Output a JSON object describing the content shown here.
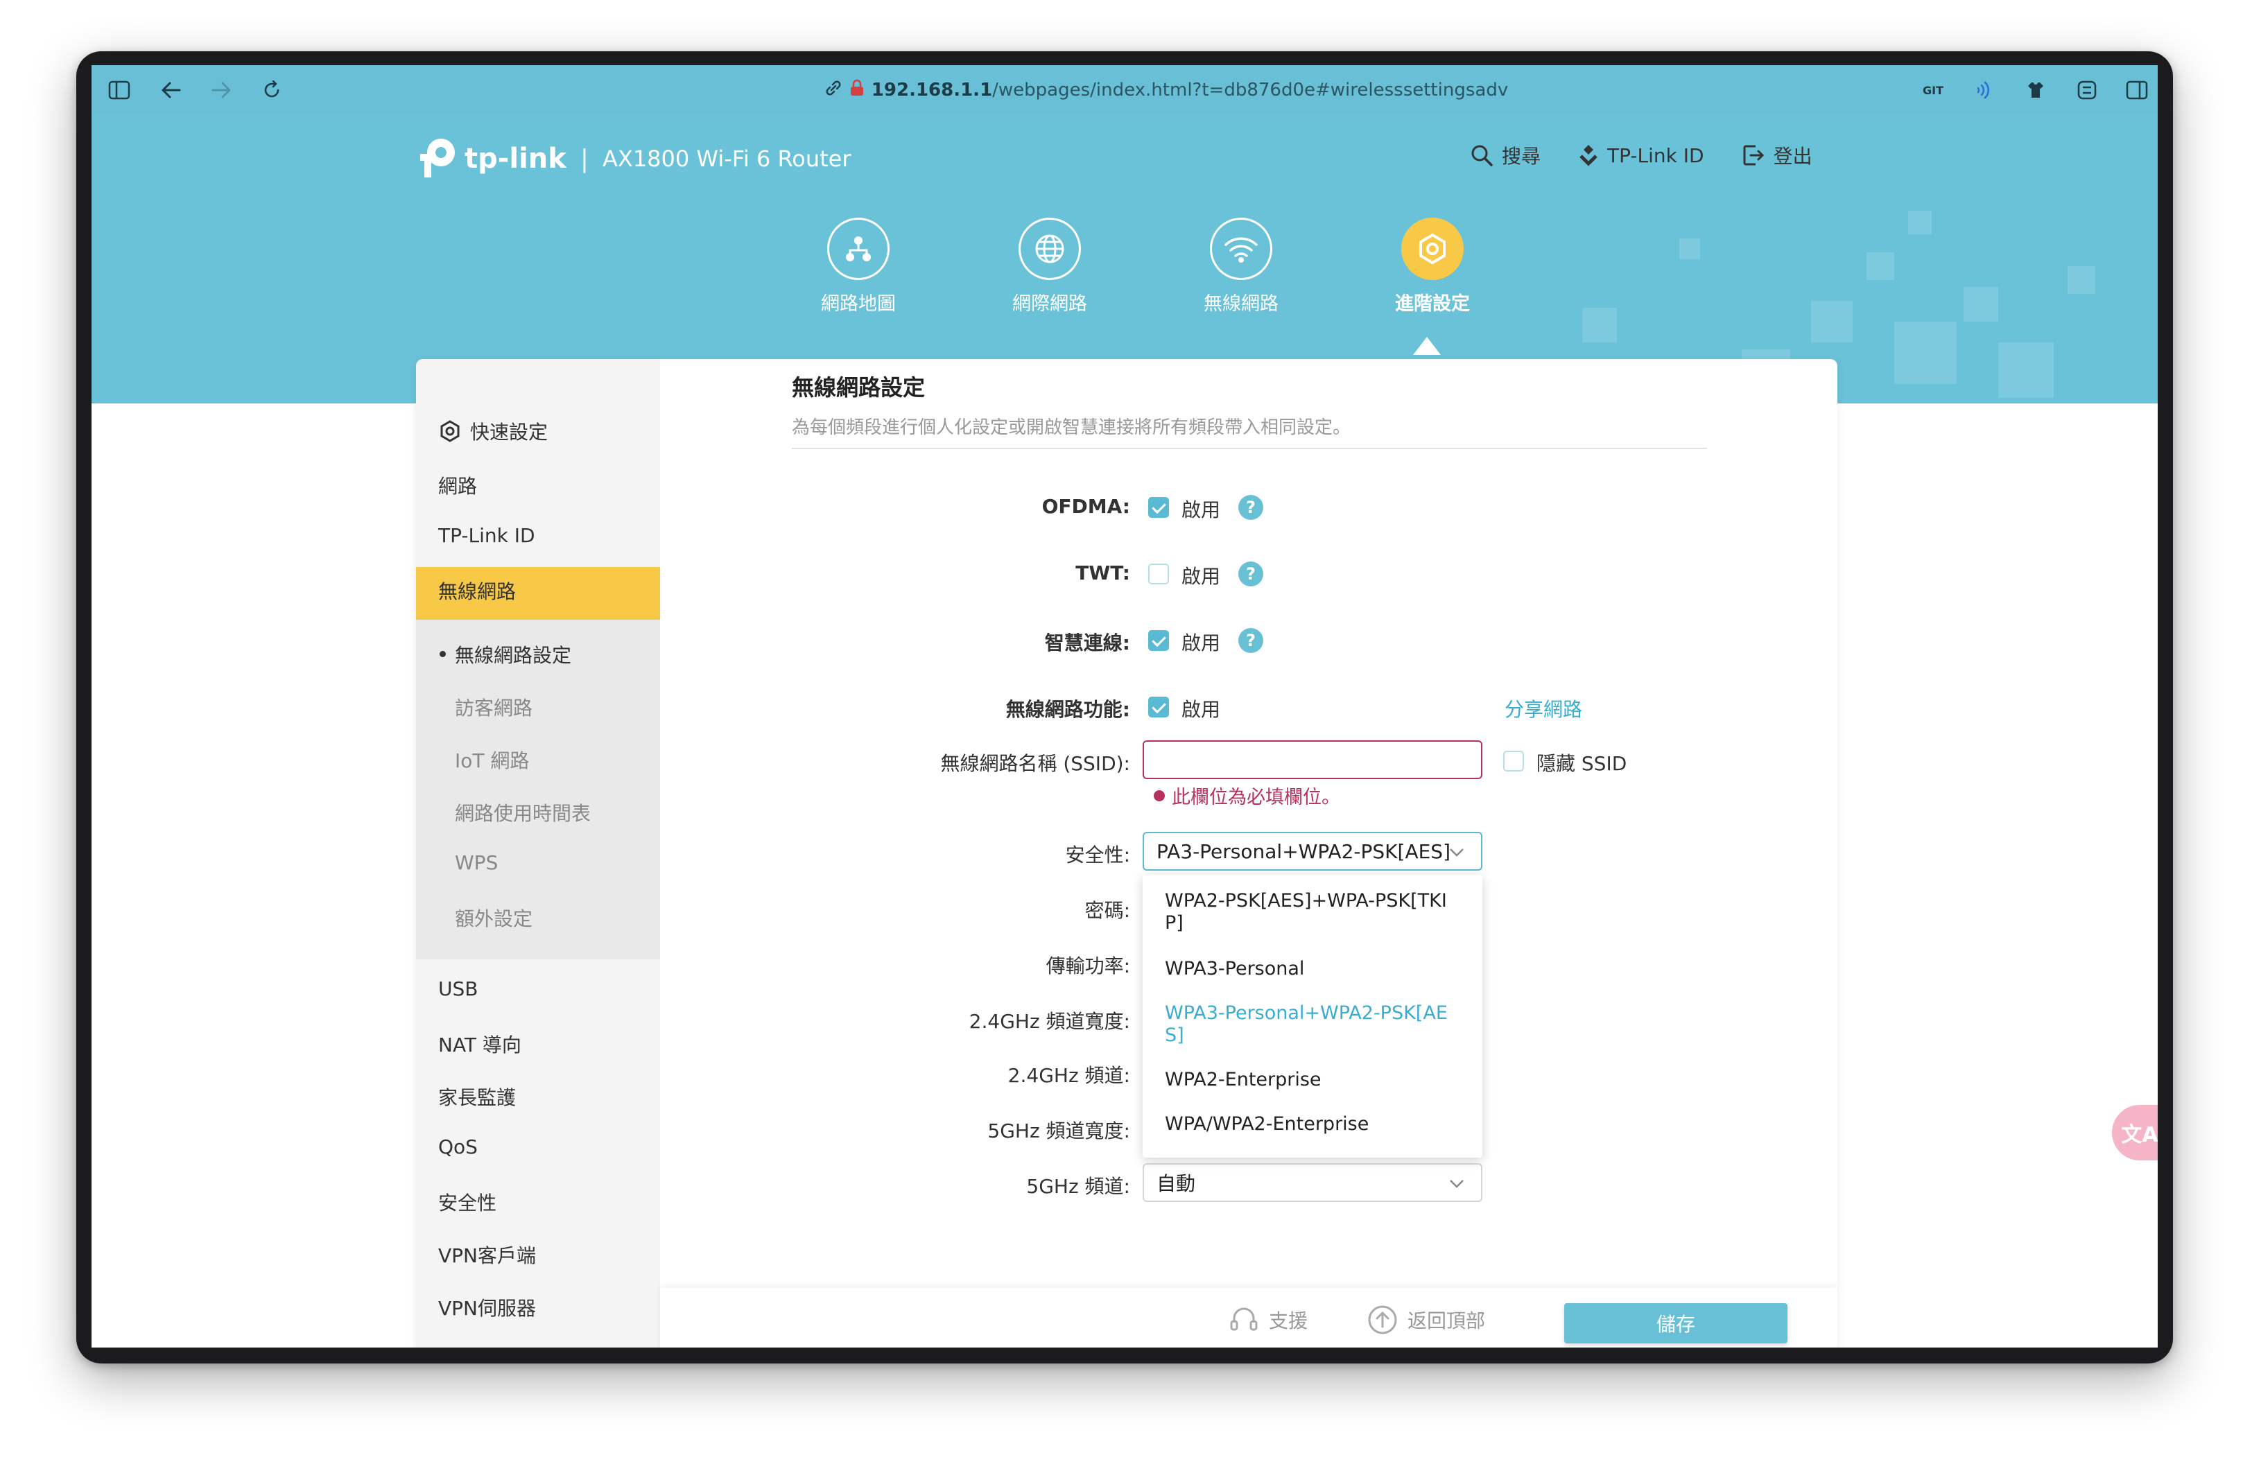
{
  "browser": {
    "url_host": "192.168.1.1",
    "url_path": "/webpages/index.html?t=db876d0e#wirelesssettingsadv",
    "ext_git_label": "GIT"
  },
  "header": {
    "brand": "tp-link",
    "model": "AX1800 Wi-Fi 6 Router",
    "links": {
      "search": "搜尋",
      "tplink_id": "TP-Link ID",
      "logout": "登出"
    },
    "nav": [
      {
        "label": "網路地圖",
        "icon": "network-map-icon"
      },
      {
        "label": "網際網路",
        "icon": "internet-globe-icon"
      },
      {
        "label": "無線網路",
        "icon": "wifi-icon"
      },
      {
        "label": "進階設定",
        "icon": "advanced-gear-icon",
        "active": true
      }
    ]
  },
  "sidebar": {
    "quick_setup": "快速設定",
    "network": "網路",
    "tplink_id": "TP-Link ID",
    "wireless": "無線網路",
    "sub": [
      "無線網路設定",
      "訪客網路",
      "IoT 網路",
      "網路使用時間表",
      "WPS",
      "額外設定"
    ],
    "more": [
      "USB",
      "NAT 導向",
      "家長監護",
      "QoS",
      "安全性",
      "VPN客戶端",
      "VPN伺服器"
    ]
  },
  "content": {
    "title": "無線網路設定",
    "description": "為每個頻段進行個人化設定或開啟智慧連接將所有頻段帶入相同設定。",
    "enable_label": "啟用",
    "ofdma": {
      "label": "OFDMA:",
      "checked": true
    },
    "twt": {
      "label": "TWT:",
      "checked": false
    },
    "smart_connect": {
      "label": "智慧連線:",
      "checked": true
    },
    "wireless_function": {
      "label": "無線網路功能:",
      "checked": true,
      "share_link": "分享網路"
    },
    "ssid": {
      "label": "無線網路名稱 (SSID):",
      "value": "",
      "hide_label": "隱藏 SSID",
      "error": "此欄位為必填欄位。"
    },
    "security": {
      "label": "安全性:",
      "selected": "PA3-Personal+WPA2-PSK[AES]",
      "options": [
        "WPA2-PSK[AES]+WPA-PSK[TKIP]",
        "WPA3-Personal",
        "WPA3-Personal+WPA2-PSK[AES]",
        "WPA2-Enterprise",
        "WPA/WPA2-Enterprise"
      ],
      "highlighted_index": 2
    },
    "password_label": "密碼:",
    "tx_power_label": "傳輸功率:",
    "bw24_label": "2.4GHz 頻道寬度:",
    "ch24_label": "2.4GHz 頻道:",
    "bw5_label": "5GHz 頻道寬度:",
    "ch5": {
      "label": "5GHz 頻道:",
      "value": "自動"
    }
  },
  "footer": {
    "support": "支援",
    "back_to_top": "返回頂部",
    "save": "儲存"
  },
  "translate_badge": "文A",
  "colors": {
    "header_bg": "#6ac2d8",
    "accent_yellow": "#f7c947",
    "accent_blue": "#5bbad3",
    "error": "#b8315c"
  }
}
